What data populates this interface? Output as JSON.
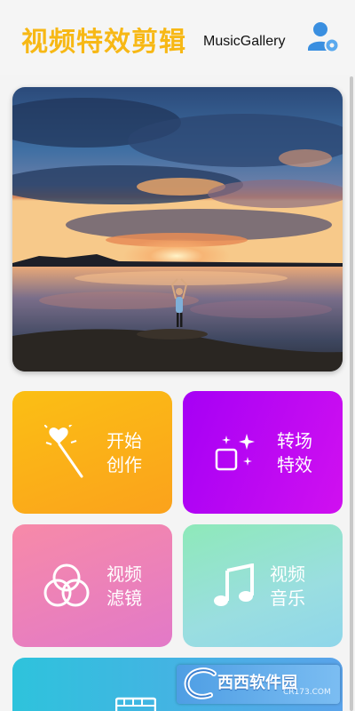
{
  "header": {
    "title": "视频特效剪辑",
    "subtitle": "MusicGallery",
    "user_icon": "user-settings-icon"
  },
  "hero": {
    "image": "sunset-lake-photo"
  },
  "tiles": [
    {
      "line1": "开始",
      "line2": "创作",
      "icon": "magic-wand-icon",
      "colors": [
        "#fbbf14",
        "#fba21c"
      ]
    },
    {
      "line1": "转场",
      "line2": "特效",
      "icon": "sparkle-square-icon",
      "colors": [
        "#a600f5",
        "#d010f0"
      ]
    },
    {
      "line1": "视频",
      "line2": "滤镜",
      "icon": "filter-circles-icon",
      "colors": [
        "#f78aa8",
        "#e279c8"
      ]
    },
    {
      "line1": "视频",
      "line2": "音乐",
      "icon": "music-note-icon",
      "colors": [
        "#8ee9b9",
        "#8fd6ea"
      ]
    }
  ],
  "bottom_tile": {
    "icon": "film-clapper-icon",
    "colors": [
      "#2ec3dc",
      "#5aa3ea"
    ]
  },
  "watermark": {
    "brand": "西西软件园",
    "site": "CR173.COM"
  },
  "accent": "#f7b815"
}
